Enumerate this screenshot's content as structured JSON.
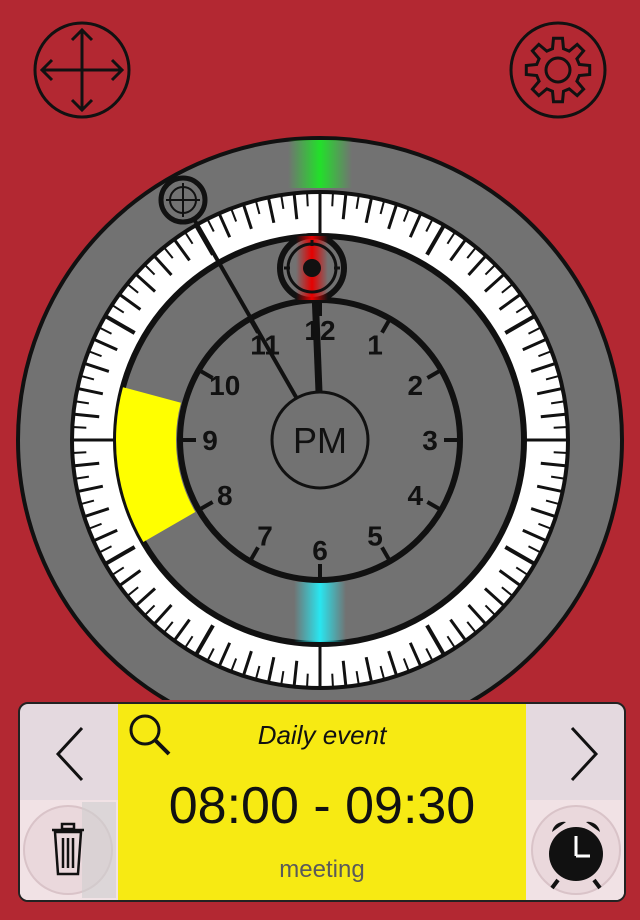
{
  "clock": {
    "period_label": "PM",
    "hour_labels": [
      "12",
      "1",
      "2",
      "3",
      "4",
      "5",
      "6",
      "7",
      "8",
      "9",
      "10",
      "11"
    ],
    "hour_hand_value": 12.0,
    "selection_start_hour": 8.0,
    "selection_end_hour": 9.5,
    "colors": {
      "background": "#b32832",
      "dial": "#727272",
      "selection": "#ffff00",
      "top_marker": "#22e02a",
      "bottom_marker": "#29e6f0",
      "knob": "#e60000"
    }
  },
  "icons": {
    "move": "move-arrows-icon",
    "settings": "gear-icon",
    "search": "magnifier-icon",
    "prev": "chevron-left-icon",
    "next": "chevron-right-icon",
    "trash": "trash-icon",
    "alarm": "alarm-clock-icon",
    "target": "crosshair-icon"
  },
  "event": {
    "type_label": "Daily event",
    "time_range": "08:00 - 09:30",
    "title": "meeting"
  }
}
